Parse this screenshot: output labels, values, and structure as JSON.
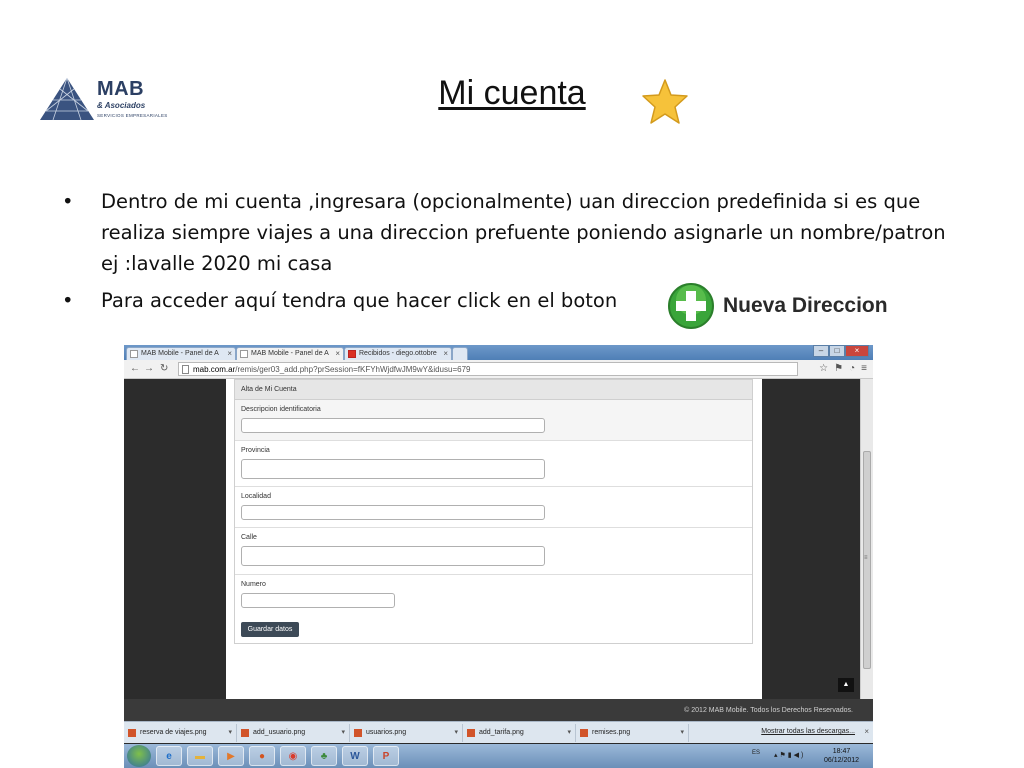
{
  "slide": {
    "title": "Mi cuenta",
    "bullets": [
      "Dentro de mi cuenta ,ingresara (opcionalmente) uan direccion predefinida si es que realiza siempre viajes a una direccion prefuente poniendo asignarle un nombre/patron ej :lavalle 2020  mi casa",
      "Para acceder aquí tendra que hacer click en el boton"
    ],
    "nueva_button_label": "Nueva Direccion"
  },
  "logo": {
    "name": "MAB",
    "subtitle": "& Asociados",
    "tagline": "SERVICIOS EMPRESARIALES"
  },
  "browser": {
    "tabs": [
      {
        "label": "MAB Mobile - Panel de A"
      },
      {
        "label": "MAB Mobile - Panel de A"
      },
      {
        "label": "Recibidos - diego.ottobre"
      }
    ],
    "url_host": "mab.com.ar",
    "url_path": "/remis/ger03_add.php?prSession=fKFYhWjdfwJM9wY&idusu=679",
    "form": {
      "title": "Alta de Mi Cuenta",
      "fields": [
        {
          "label": "Descripcion identificatoria"
        },
        {
          "label": "Provincia"
        },
        {
          "label": "Localidad"
        },
        {
          "label": "Calle"
        },
        {
          "label": "Numero"
        }
      ],
      "submit_label": "Guardar datos"
    },
    "footer_text": "© 2012 MAB Mobile. Todos los Derechos Reservados.",
    "downloads": [
      {
        "name": "reserva de viajes.png"
      },
      {
        "name": "add_usuario.png"
      },
      {
        "name": "usuarios.png"
      },
      {
        "name": "add_tarifa.png"
      },
      {
        "name": "remises.png"
      }
    ],
    "downloads_all": "Mostrar todas las descargas..."
  },
  "taskbar": {
    "lang": "ES",
    "time": "18:47",
    "date": "06/12/2012"
  },
  "colors": {
    "logo_blue": "#2b3f63",
    "star_yellow": "#f6c23a",
    "plus_green": "#3aa53a",
    "button_dark": "#3d4a57"
  }
}
